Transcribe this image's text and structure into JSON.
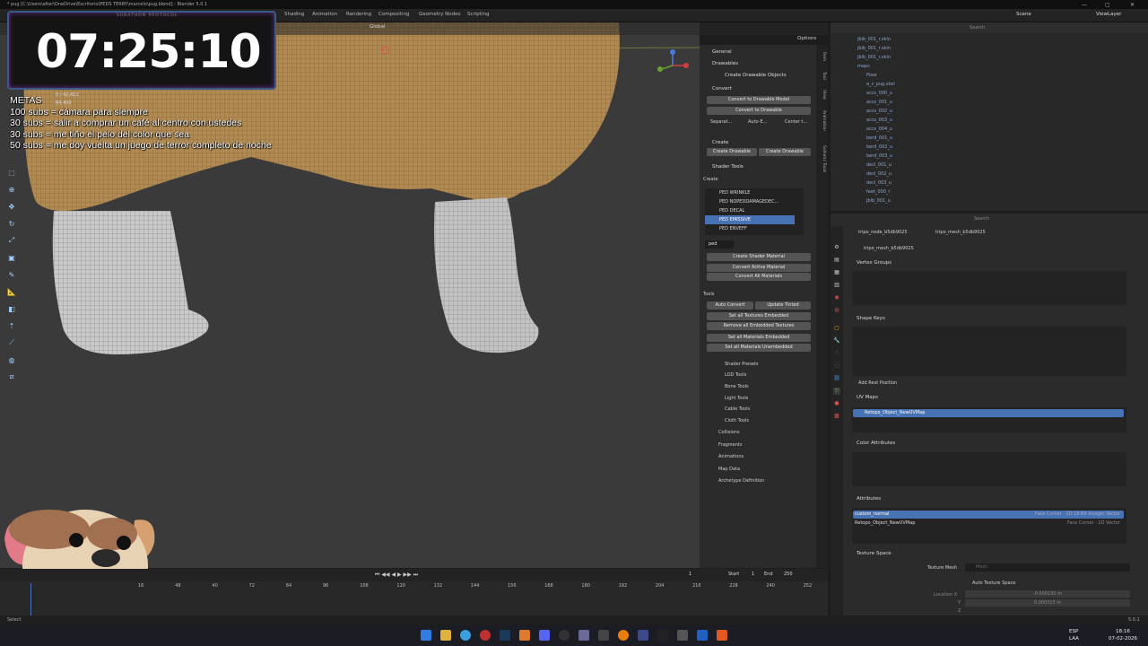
{
  "window": {
    "title": "* pug [C:\\Users\\elter\\OneDrive\\Escritorio\\PEDS TERRY\\marcelo\\pug.blend] - Blender 5.0.1",
    "controls": [
      "—",
      "▢",
      "✕"
    ]
  },
  "workspaces": [
    "Shading",
    "Animation",
    "Rendering",
    "Compositing",
    "Geometry Nodes",
    "Scripting"
  ],
  "top_right": {
    "scene": "Scene",
    "view_layer": "ViewLayer"
  },
  "viewport_header": {
    "orientation": "Global",
    "options": "Options"
  },
  "overlay": {
    "timer": "07:25:10",
    "subathon": "SUBATHON PROTOCOL",
    "stat1": "0 / 42,411",
    "stat2": "84,400",
    "metas_title": "METAS",
    "metas": [
      "100 subs = cámara para siempre",
      "30 subs = salir a comprar un café al centro con ustedes",
      "30 subs = me tiño el pelo del color que sea",
      "50 subs = me doy vuelta un juego de terror completo de noche"
    ]
  },
  "npanel": {
    "general": "General",
    "drawables": "Drawables",
    "create_drawable_objects": "Create Drawable Objects",
    "convert": "Convert",
    "convert_to_drawable_model": "Convert to Drawable Model",
    "convert_to_drawable": "Convert to Drawable",
    "separate": "Separat...",
    "auto_embed": "Auto-E...",
    "center": "Center t...",
    "create": "Create",
    "create_drawable": "Create Drawable",
    "create_drawable2": "Create Drawable",
    "shader_tools": "Shader Tools",
    "create_lbl": "Create",
    "shaders": [
      "PED WRINKLE",
      "PED NOPEDDAMAGEDEC...",
      "PED DECAL",
      "PED EMISSIVE",
      "PED ENVEFF"
    ],
    "search_value": "ped",
    "create_shader_material": "Create Shader Material",
    "convert_active_material": "Convert Active Material",
    "convert_all_materials": "Convert All Materials",
    "tools": "Tools",
    "auto_convert": "Auto Convert",
    "update_tinted": "Update Tinted",
    "set_textures_embedded": "Set all Textures Embedded",
    "remove_embedded_textures": "Remove all Embedded Textures",
    "set_materials_embedded": "Set all Materials Embedded",
    "set_materials_unembedded": "Set all Materials Unembedded",
    "subpanels": [
      "Shader Presets",
      "LOD Tools",
      "Bone Tools",
      "Light Tools",
      "Cable Tools",
      "Cloth Tools"
    ],
    "sections": [
      "Collisions",
      "Fragments",
      "Animations",
      "Map Data",
      "Archetype Definition"
    ],
    "side_tabs": [
      "Item",
      "Tool",
      "View",
      "Animation",
      "Sollumz Tools"
    ]
  },
  "outliner": {
    "search_placeholder": "Search",
    "rows": [
      "jbib_001_r.skin",
      "jbib_001_r.skin",
      "jbib_001_r.skin",
      "maps",
      "Pose",
      "a_c_pug.skel",
      "accs_000_u",
      "accs_001_u",
      "accs_002_u",
      "accs_003_u",
      "accs_004_u",
      "berd_001_u",
      "berd_002_u",
      "berd_003_u",
      "decl_001_u",
      "decl_002_u",
      "decl_003_u",
      "feet_000_r",
      "jbib_001_u"
    ]
  },
  "properties": {
    "search_placeholder": "Search",
    "breadcrumb_obj": "tripo_node_b5db9025",
    "breadcrumb_mesh": "tripo_mesh_b5db9025",
    "mesh_name": "tripo_mesh_b5db9025",
    "vertex_groups": "Vertex Groups",
    "shape_keys": "Shape Keys",
    "add_rest_position": "Add Rest Position",
    "uv_maps": "UV Maps",
    "uv_map_name": "Retopo_Object_NewUVMap",
    "color_attributes": "Color Attributes",
    "attributes": "Attributes",
    "attr_rows": [
      {
        "name": "custom_normal",
        "info": "Face Corner · 2D 16-Bit Integer Vector"
      },
      {
        "name": "Retopo_Object_NewUVMap",
        "info": "Face Corner · 2D Vector"
      }
    ],
    "texture_space": "Texture Space",
    "texture_mesh": "Texture Mesh",
    "texture_mesh_placeholder": "Mesh",
    "auto_texture_space": "Auto Texture Space",
    "location_x": "Location X",
    "loc_x_val": "-0.000191 m",
    "loc_y": "Y",
    "loc_y_val": "0.000315 m",
    "loc_z": "Z"
  },
  "timeline": {
    "current_frame": "1",
    "start_label": "Start",
    "start": "1",
    "end_label": "End",
    "end": "250",
    "ticks": [
      "16",
      "48",
      "40",
      "72",
      "84",
      "96",
      "108",
      "120",
      "132",
      "144",
      "156",
      "168",
      "180",
      "192",
      "204",
      "216",
      "228",
      "240",
      "252"
    ]
  },
  "statusbar": {
    "left": "Select",
    "version": "5.0.1"
  },
  "taskbar": {
    "lang1": "ESP",
    "lang2": "LAA",
    "time": "18:16",
    "date": "07-02-2026"
  },
  "colors": {
    "accent": "#4772b3",
    "viewport": "#3a3a3a",
    "panel": "#2b2b2b"
  }
}
